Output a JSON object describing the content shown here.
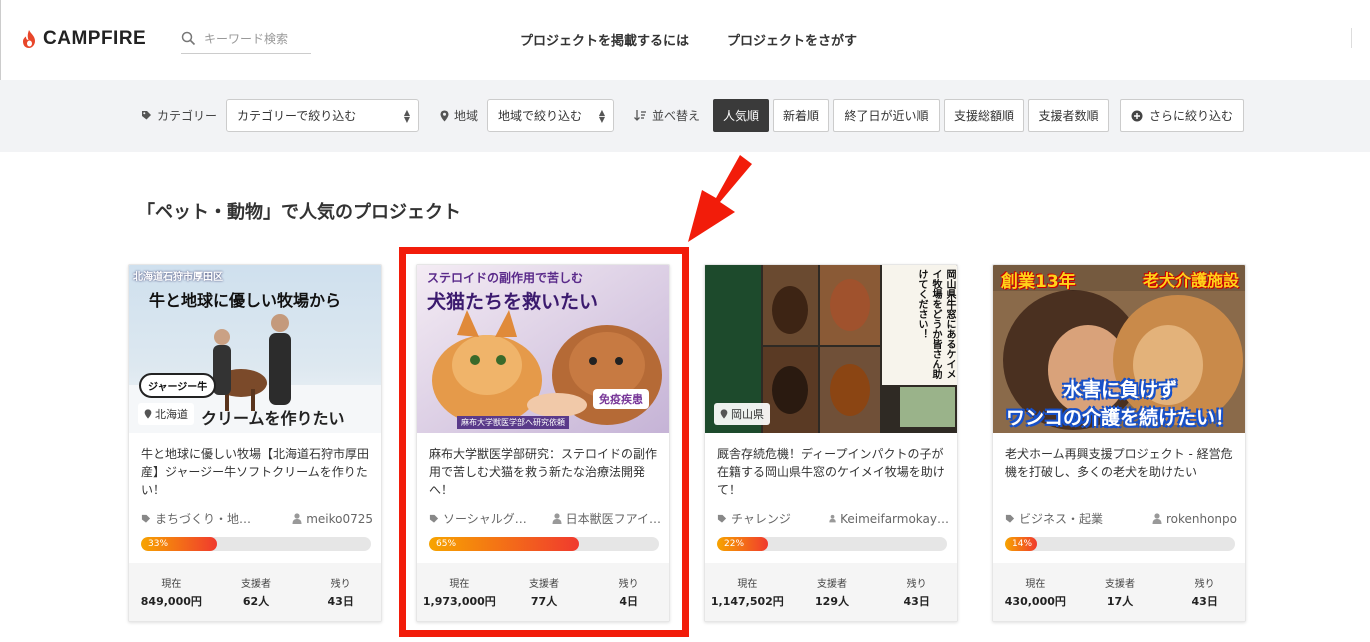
{
  "header": {
    "logo_text": "CAMPFIRE",
    "search_placeholder": "キーワード検索",
    "nav": [
      "プロジェクトを掲載するには",
      "プロジェクトをさがす"
    ]
  },
  "filters": {
    "category_label": "カテゴリー",
    "category_select": "カテゴリーで絞り込む",
    "region_label": "地域",
    "region_select": "地域で絞り込む",
    "sort_label": "並べ替え",
    "sort_options": [
      "人気順",
      "新着順",
      "終了日が近い順",
      "支援総額順",
      "支援者数順"
    ],
    "sort_active": "人気順",
    "more_filter": "さらに絞り込む"
  },
  "section_title": "「ペット・動物」で人気のプロジェクト",
  "stat_labels": {
    "current": "現在",
    "backers": "支援者",
    "remaining": "残り"
  },
  "cards": [
    {
      "thumb_top": "北海道石狩市厚田区",
      "thumb_headline": "牛と地球に優しい牧場から",
      "thumb_badge": "ジャージー牛",
      "thumb_bottom": "クリームを作りたい",
      "location": "北海道",
      "title": "牛と地球に優しい牧場【北海道石狩市厚田産】ジャージー牛ソフトクリームを作りたい！",
      "category": "まちづくり・地…",
      "owner": "meiko0725",
      "progress": 33,
      "progress_label": "33%",
      "current": "849,000円",
      "backers": "62人",
      "remaining": "43日"
    },
    {
      "thumb_top": "ステロイドの副作用で苦しむ",
      "thumb_headline": "犬猫たちを救いたい",
      "thumb_badge": "免疫疾患",
      "thumb_bottom": "麻布大学獣医学部へ研究依頼",
      "title": "麻布大学獣医学部研究：ステロイドの副作用で苦しむ犬猫を救う新たな治療法開発へ！",
      "category": "ソーシャルグ…",
      "owner": "日本獣医フアイ…",
      "progress": 65,
      "progress_label": "65%",
      "current": "1,973,000円",
      "backers": "77人",
      "remaining": "4日"
    },
    {
      "thumb_side": "岡山県牛窓にあるケイメイ牧場をどうか皆さん助けてください！",
      "location": "岡山県",
      "title": "厩舎存続危機！ディープインパクトの子が在籍する岡山県牛窓のケイメイ牧場を助けて！",
      "category": "チャレンジ",
      "owner": "Keimeifarmokay…",
      "progress": 22,
      "progress_label": "22%",
      "current": "1,147,502円",
      "backers": "129人",
      "remaining": "43日"
    },
    {
      "thumb_top_left": "創業13年",
      "thumb_top_right": "老犬介護施設",
      "thumb_bottom1": "水害に負けず",
      "thumb_bottom2": "ワンコの介護を続けたい！",
      "title": "老犬ホーム再興支援プロジェクト - 経営危機を打破し、多くの老犬を助けたい",
      "category": "ビジネス・起業",
      "owner": "rokenhonpo",
      "progress": 14,
      "progress_label": "14%",
      "current": "430,000円",
      "backers": "17人",
      "remaining": "43日"
    }
  ],
  "colors": {
    "brand": "#e8462a",
    "highlight": "#f21c0a",
    "progress_start": "#f7a400",
    "progress_end": "#f03a2e"
  }
}
